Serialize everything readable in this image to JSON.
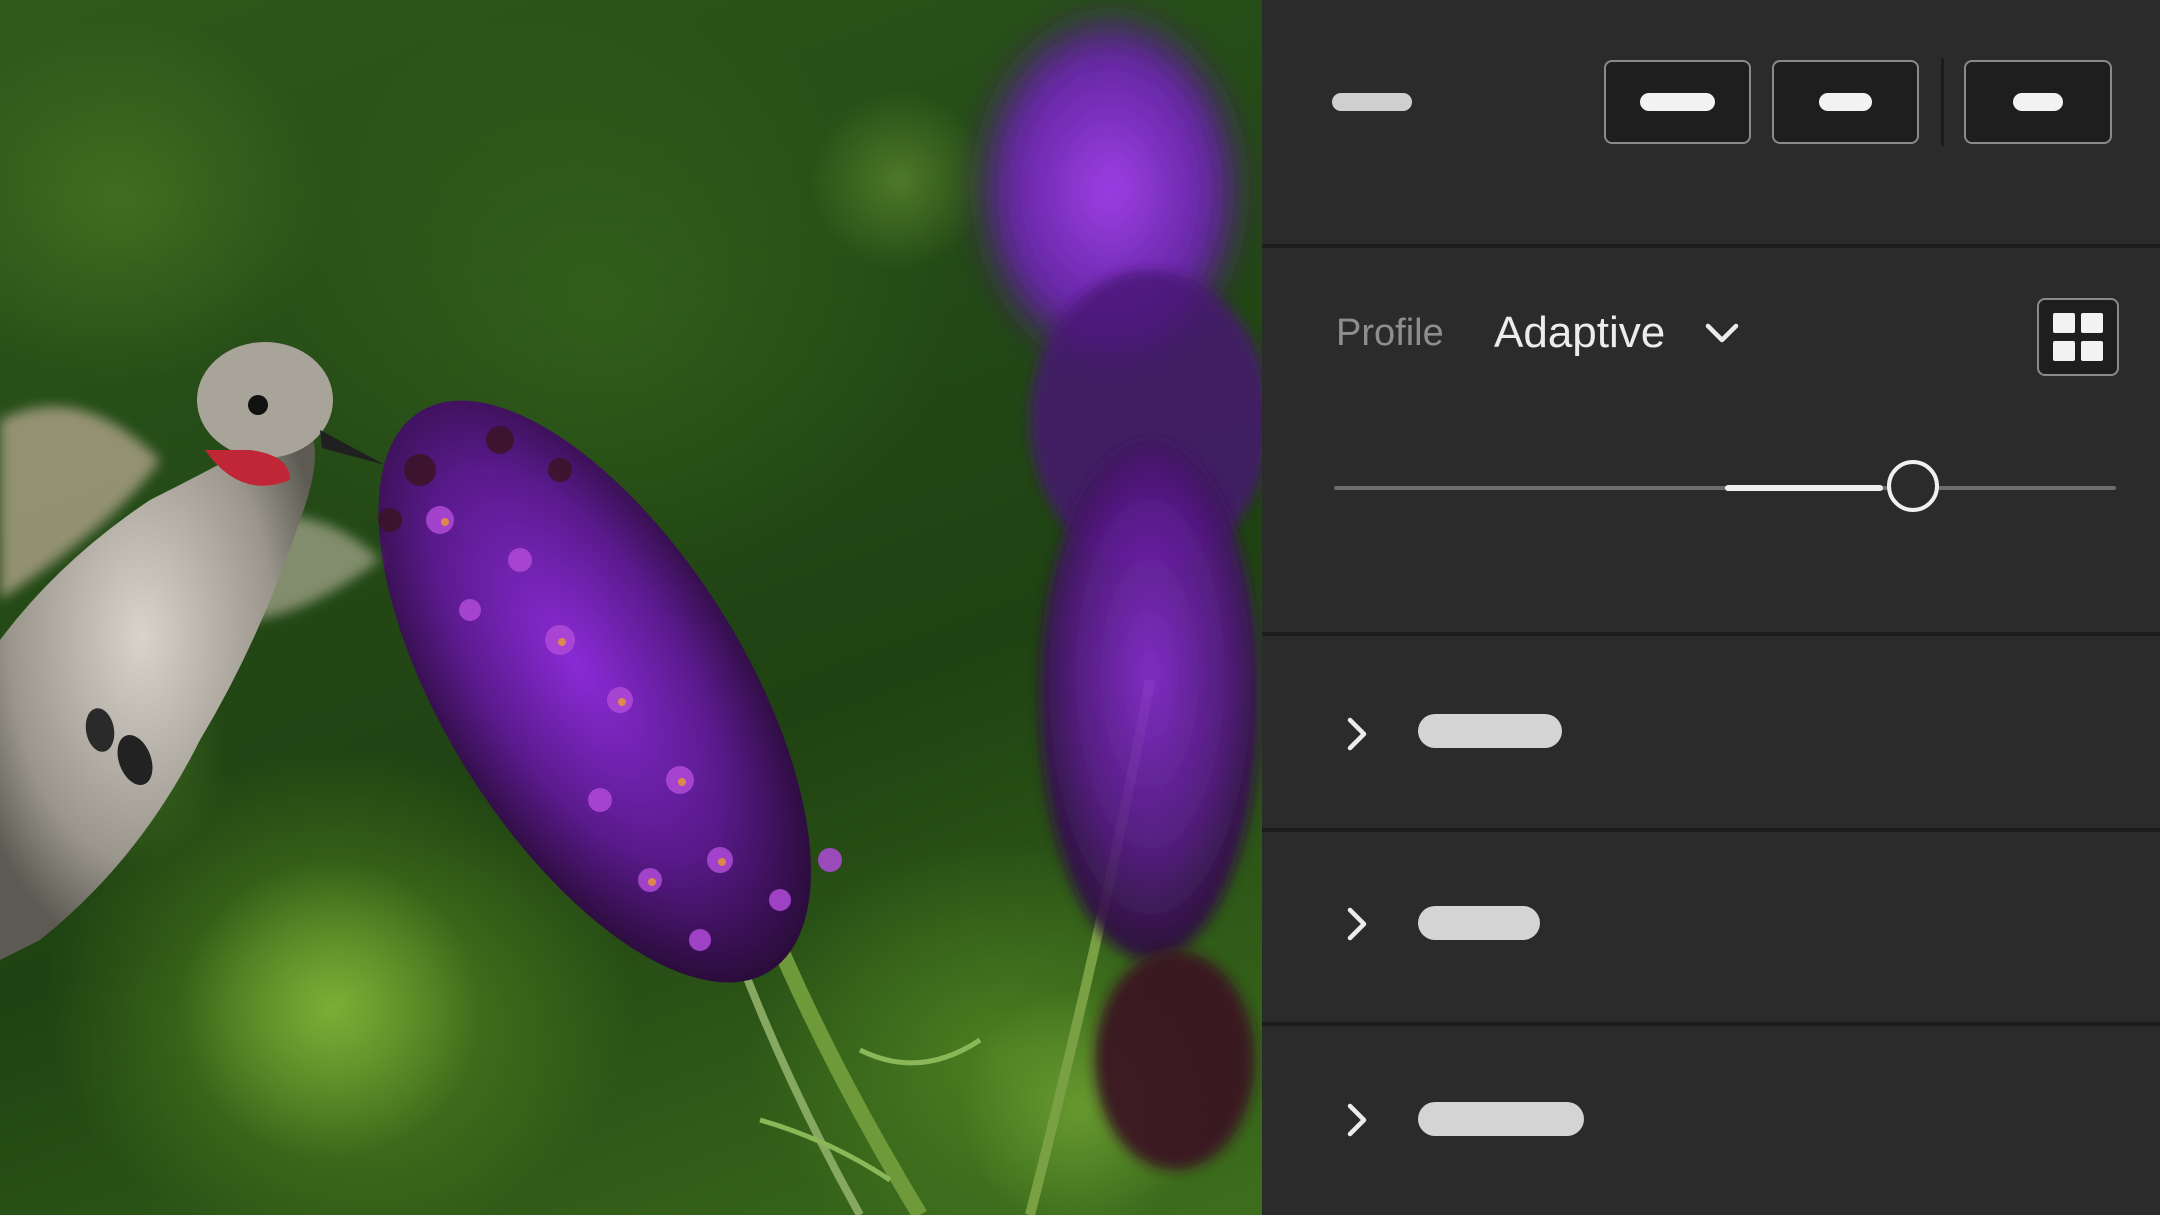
{
  "photo": {
    "subject": "hummingbird-and-purple-flowers"
  },
  "panel": {
    "toolbar": {
      "buttons": [
        "primary-toggle",
        "secondary-toggle",
        "tertiary-toggle"
      ]
    },
    "profile": {
      "label": "Profile",
      "value": "Adaptive",
      "browse_icon": "grid-icon"
    },
    "amount_slider": {
      "value_fraction": 0.74,
      "range_start_fraction": 0.5
    },
    "sections": [
      {
        "expanded": false,
        "icon": "chevron-right-icon"
      },
      {
        "expanded": false,
        "icon": "chevron-right-icon"
      },
      {
        "expanded": false,
        "icon": "chevron-right-icon"
      }
    ]
  },
  "colors": {
    "panel_bg": "#2b2b2b",
    "divider": "#1c1c1c",
    "text_primary": "#ececec",
    "text_secondary": "#8e8e8e",
    "accent": "#f0f0f0"
  }
}
